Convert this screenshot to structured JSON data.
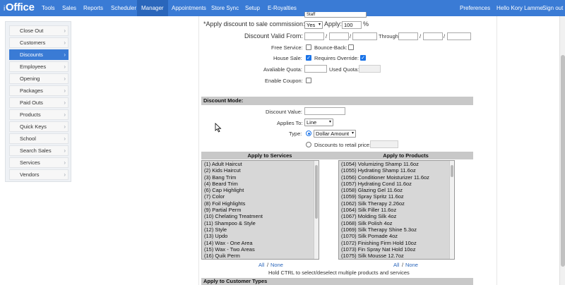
{
  "app": {
    "logo_prefix": "i",
    "logo_main": "Office"
  },
  "nav": {
    "items": [
      "Tools",
      "Sales",
      "Reports",
      "Scheduler",
      "Manager",
      "Appointments",
      "Store Sync",
      "Setup",
      "E-Royalties"
    ],
    "active": "Manager",
    "preferences": "Preferences",
    "greeting": "Hello Kory Lamme",
    "signout": "Sign out"
  },
  "sidebar": {
    "items": [
      {
        "label": "Close Out"
      },
      {
        "label": "Customers"
      },
      {
        "label": "Discounts"
      },
      {
        "label": "Employees"
      },
      {
        "label": "Opening"
      },
      {
        "label": "Packages"
      },
      {
        "label": "Paid Outs"
      },
      {
        "label": "Products"
      },
      {
        "label": "Quick Keys"
      },
      {
        "label": "School"
      },
      {
        "label": "Search Sales"
      },
      {
        "label": "Services"
      },
      {
        "label": "Vendors"
      }
    ],
    "active": "Discounts"
  },
  "form": {
    "top_partial_value": "Staff",
    "apply_commission_label": "*Apply discount to sale commission:",
    "apply_commission_value": "Yes",
    "apply_label": "Apply:",
    "apply_value": "100",
    "apply_unit": "%",
    "valid_from_label": "Discount Valid From:",
    "slash": "/",
    "through_label": "Through",
    "free_service_label": "Free Service:",
    "bounce_back_label": "Bounce-Back:",
    "house_sale_label": "House Sale:",
    "requires_override_label": "Requires Override:",
    "available_quota_label": "Avaliable Quota:",
    "used_quota_label": "Used Quota:",
    "enable_coupon_label": "Enable Coupon:"
  },
  "mode": {
    "title": "Discount Mode:",
    "value_label": "Discount Value:",
    "applies_to_label": "Applies To:",
    "applies_to_value": "Line",
    "type_label": "Type:",
    "type_value": "Dollar Amount",
    "retail_label": "Discounts to retail price:"
  },
  "services": {
    "title": "Apply to Services",
    "items": [
      "(1)  Adult Haircut",
      "(2)  Kids Haircut",
      "(3)  Bang Trim",
      "(4)  Beard Trim",
      "(6)  Cap Highlight",
      "(7)  Color",
      "(8)  Foil Highlights",
      "(9)  Partial Perm",
      "(10)  Chelating Treatment",
      "(11)  Shampoo & Style",
      "(12)  Style",
      "(13)  Updo",
      "(14)  Wax - One Area",
      "(15)  Wax - Two Areas",
      "(16)  Quik Perm"
    ],
    "all_label": "All",
    "none_label": "None",
    "sep": "/"
  },
  "products": {
    "title": "Apply to Products",
    "items": [
      "(1054)  Volumizing Shamp 11.6oz",
      "(1055)  Hydrating Shamp 11.6oz",
      "(1056)  Conditioner Moisturizer 11.6oz",
      "(1057)  Hydrating Cond 11.6oz",
      "(1058)  Glazing Gel 11.6oz",
      "(1059)  Spray Spritz 11.6oz",
      "(1062)  Silk Therapy 2.26oz",
      "(1064)  Silk Filler 11.6oz",
      "(1067)  Molding Silk 4oz",
      "(1068)  Silk Polish 4oz",
      "(1069)  Silk Therapy Shine 5.3oz",
      "(1070)  Silk Pomade 4oz",
      "(1072)  Finishing Firm Hold 10oz",
      "(1073)  Fin Spray Nat Hold 10oz",
      "(1075)  Silk Mousse 12.7oz"
    ],
    "all_label": "All",
    "none_label": "None",
    "sep": "/"
  },
  "hint": "Hold CTRL to select/deselect multiple products and services",
  "customer_types_title": "Apply to Customer Types",
  "colors": {
    "nav": "#3a7bd5",
    "nav_active": "#2a66bb",
    "section": "#c8c8c8"
  }
}
